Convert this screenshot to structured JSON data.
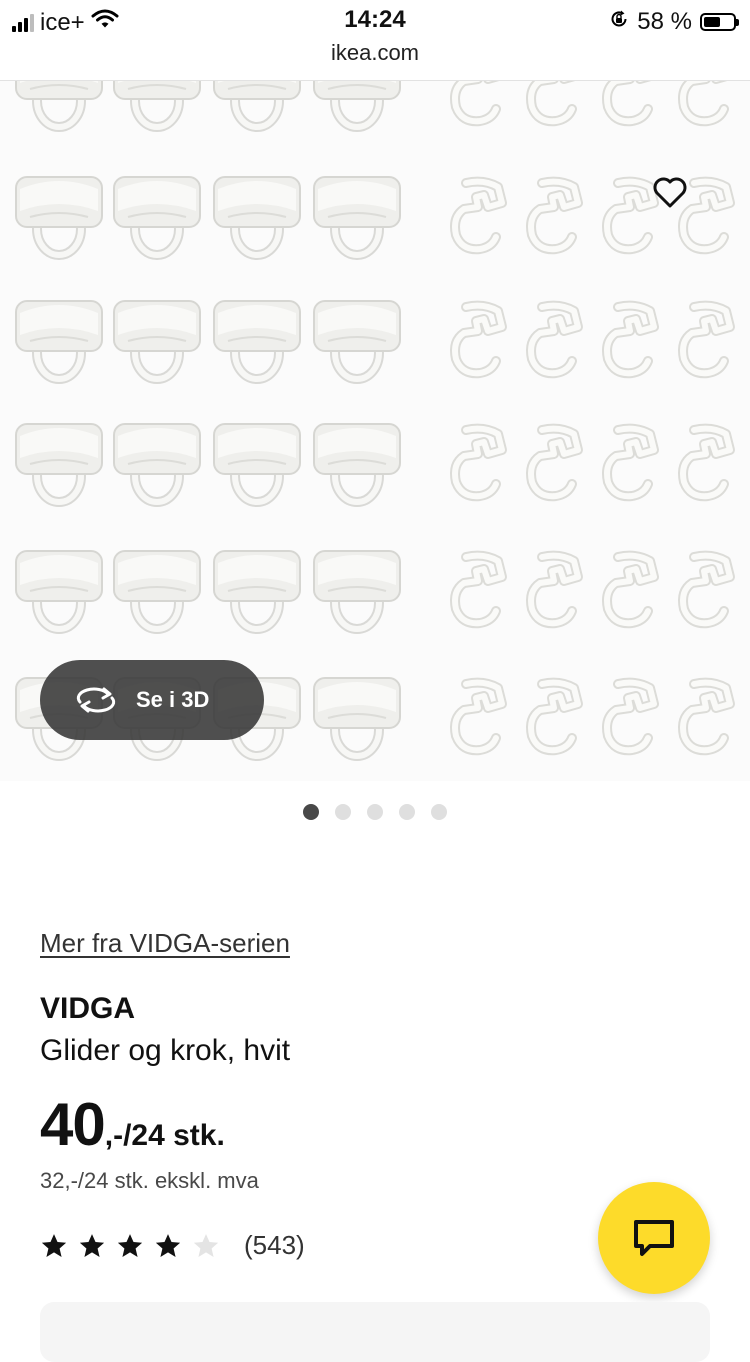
{
  "status_bar": {
    "carrier": "ice+",
    "time": "14:24",
    "url": "ikea.com",
    "battery_percent": "58 %",
    "battery_level": 0.58
  },
  "gallery": {
    "view_3d_label": "Se i 3D",
    "total_images": 5,
    "active_image": 1
  },
  "product": {
    "series_link": "Mer fra VIDGA-serien",
    "name": "VIDGA",
    "description": "Glider og krok, hvit",
    "price_integer": "40",
    "price_suffix": ",-/24 stk.",
    "price_ex_vat": "32,-/24 stk. ekskl. mva",
    "rating_value": 4,
    "rating_max": 5,
    "rating_count": "(543)"
  },
  "colors": {
    "accent_yellow": "#fddb2a",
    "text_dark": "#111111",
    "badge_bg": "#373737",
    "active_dot": "#484848",
    "inactive_dot": "#dfdfdf"
  },
  "icons": {
    "favorite": "heart-icon",
    "rotate_3d": "rotate-3d-icon",
    "chat": "chat-icon",
    "star": "star-icon"
  }
}
